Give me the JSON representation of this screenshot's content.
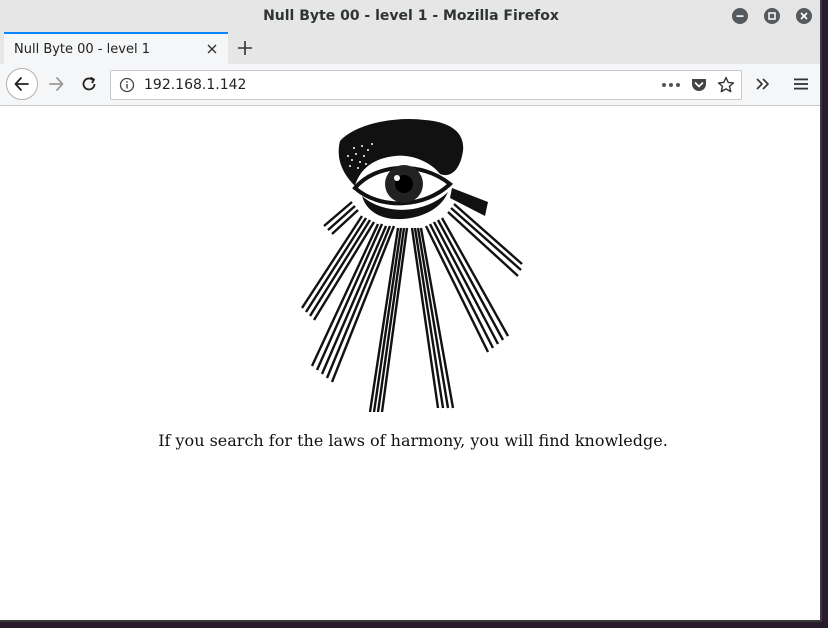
{
  "window": {
    "title": "Null Byte 00 - level 1 - Mozilla Firefox"
  },
  "tabs": [
    {
      "label": "Null Byte 00 - level 1",
      "active": true
    }
  ],
  "navbar": {
    "url": "192.168.1.142"
  },
  "content": {
    "quote": "If you search for the laws of harmony, you will find knowledge."
  },
  "icons": {
    "minimize": "minimize-icon",
    "maximize": "maximize-icon",
    "close": "close-icon",
    "tab_close": "close-icon",
    "new_tab": "plus-icon",
    "back": "arrow-left-icon",
    "forward": "arrow-right-icon",
    "reload": "reload-icon",
    "site_info": "info-icon",
    "page_actions": "ellipsis-icon",
    "pocket": "pocket-icon",
    "bookmark": "star-icon",
    "overflow": "double-chevron-icon",
    "menu": "hamburger-icon",
    "illustration": "all-seeing-eye-illustration"
  },
  "colors": {
    "tab_accent": "#0a84ff",
    "chrome_bg": "#e6e6e6",
    "toolbar_bg": "#f5f6f7"
  }
}
